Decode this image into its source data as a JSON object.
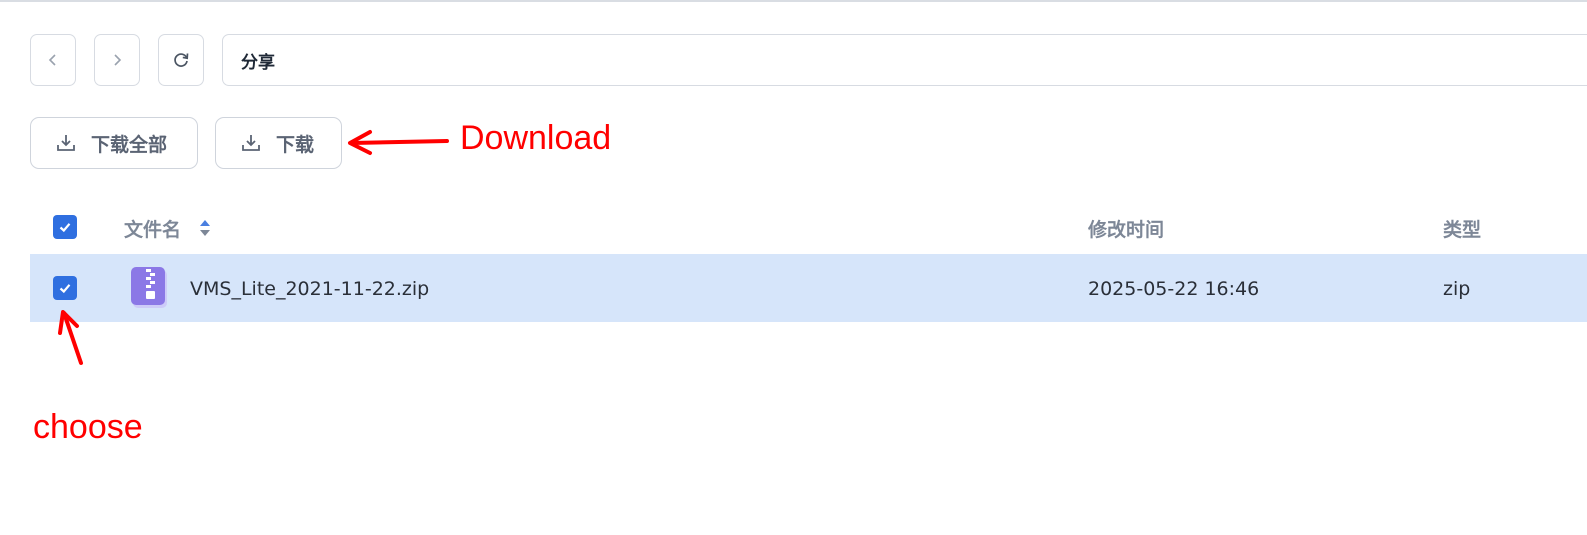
{
  "toolbar": {
    "path": "分享"
  },
  "actions": {
    "download_all_label": "下载全部",
    "download_label": "下载"
  },
  "table": {
    "columns": [
      "文件名",
      "修改时间",
      "类型"
    ],
    "rows": [
      {
        "name": "VMS_Lite_2021-11-22.zip",
        "modified": "2025-05-22 16:46",
        "type": "zip",
        "selected": true
      }
    ]
  },
  "annotations": {
    "download": "Download",
    "choose": "choose"
  },
  "colors": {
    "accent": "#2f6fe0",
    "selected_row": "#d6e5fa",
    "annotation": "#ff0000",
    "zip_icon": "#8b78e6"
  },
  "icons": [
    "chevron-left-icon",
    "chevron-right-icon",
    "refresh-icon",
    "download-icon",
    "sort-icon",
    "zip-file-icon",
    "check-icon"
  ]
}
